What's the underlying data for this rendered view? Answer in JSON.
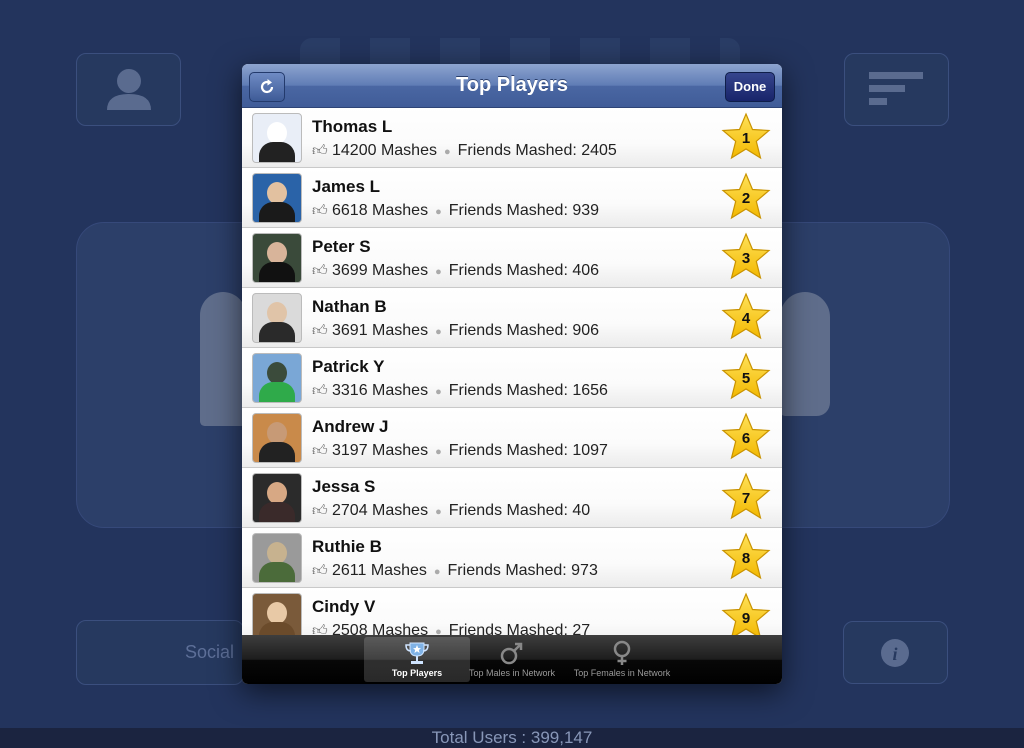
{
  "background": {
    "social_label": "Social",
    "footer_text": "Total Users : 399,147",
    "icons": [
      "person-icon",
      "sort-icon",
      "info-icon"
    ]
  },
  "modal": {
    "title": "Top Players",
    "refresh_icon": "refresh-icon",
    "done_label": "Done"
  },
  "players": [
    {
      "name": "Thomas L",
      "mashes": "14200 Mashes",
      "friends": "Friends Mashed: 2405",
      "rank": "1"
    },
    {
      "name": "James L",
      "mashes": "6618 Mashes",
      "friends": "Friends Mashed: 939",
      "rank": "2"
    },
    {
      "name": "Peter S",
      "mashes": "3699 Mashes",
      "friends": "Friends Mashed: 406",
      "rank": "3"
    },
    {
      "name": "Nathan B",
      "mashes": "3691 Mashes",
      "friends": "Friends Mashed: 906",
      "rank": "4"
    },
    {
      "name": "Patrick Y",
      "mashes": "3316 Mashes",
      "friends": "Friends Mashed: 1656",
      "rank": "5"
    },
    {
      "name": "Andrew J",
      "mashes": "3197 Mashes",
      "friends": "Friends Mashed: 1097",
      "rank": "6"
    },
    {
      "name": "Jessa S",
      "mashes": "2704 Mashes",
      "friends": "Friends Mashed: 40",
      "rank": "7"
    },
    {
      "name": "Ruthie B",
      "mashes": "2611 Mashes",
      "friends": "Friends Mashed: 973",
      "rank": "8"
    },
    {
      "name": "Cindy V",
      "mashes": "2508 Mashes",
      "friends": "Friends Mashed: 27",
      "rank": "9"
    }
  ],
  "tabs": [
    {
      "label": "Top Players",
      "icon": "trophy-icon",
      "active": true
    },
    {
      "label": "Top Males in Network",
      "icon": "male-symbol-icon",
      "active": false
    },
    {
      "label": "Top Females in Network",
      "icon": "female-symbol-icon",
      "active": false
    }
  ],
  "colors": {
    "nav_blue": "#5f7cb5",
    "star_gold": "#f6c400",
    "background_navy": "#23345d"
  }
}
